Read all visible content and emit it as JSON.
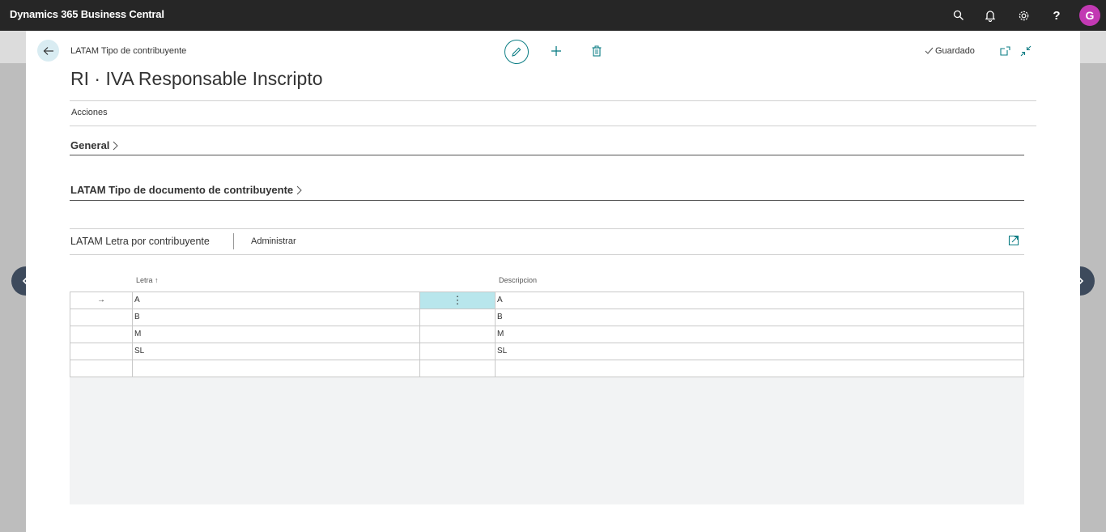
{
  "app": {
    "title": "Dynamics 365 Business Central",
    "user_initial": "G"
  },
  "topbar_icons": [
    "search-icon",
    "bell-icon",
    "gear-icon",
    "help-icon"
  ],
  "topbar": {
    "help_glyph": "?"
  },
  "page": {
    "breadcrumb": "LATAM Tipo de contribuyente",
    "title": "RI · IVA Responsable Inscripto",
    "status": "Guardado",
    "actions_label": "Acciones"
  },
  "fasttabs": [
    {
      "label": "General"
    },
    {
      "label": "LATAM Tipo de documento de contribuyente"
    }
  ],
  "subpage": {
    "title": "LATAM Letra por contribuyente",
    "manage_label": "Administrar",
    "columns": {
      "letter": "Letra ↑",
      "description": "Descripcion"
    },
    "rows": [
      {
        "letter": "A",
        "description": "A",
        "current": true
      },
      {
        "letter": "B",
        "description": "B",
        "current": false
      },
      {
        "letter": "M",
        "description": "M",
        "current": false
      },
      {
        "letter": "SL",
        "description": "SL",
        "current": false
      },
      {
        "letter": "",
        "description": "",
        "current": false
      }
    ],
    "row_marker": "→",
    "row_menu": "⋮"
  },
  "colors": {
    "topbar": "#262626",
    "accent": "#0b7d84",
    "avatar": "#c239b3",
    "selected_cell": "#b8e6ec"
  }
}
